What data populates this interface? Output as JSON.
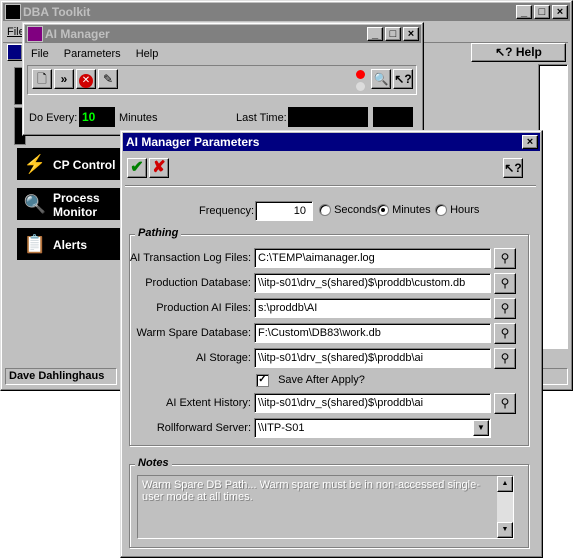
{
  "toolkit": {
    "title": "DBA Toolkit",
    "menu_file": "File",
    "help": "Help",
    "status_user": "Dave Dahlinghaus",
    "nav": [
      {
        "label": "CP Control",
        "icon": "cp-control-icon"
      },
      {
        "label": "Process Monitor",
        "icon": "process-monitor-icon"
      },
      {
        "label": "Alerts",
        "icon": "alerts-icon"
      }
    ]
  },
  "ai_manager": {
    "title": "AI Manager",
    "menu": [
      "File",
      "Parameters",
      "Help"
    ],
    "do_every_label": "Do Every:",
    "do_every_value": "10",
    "do_every_unit": "Minutes",
    "last_time_label": "Last Time:"
  },
  "params": {
    "title": "AI Manager Parameters",
    "frequency_label": "Frequency:",
    "frequency_value": "10",
    "unit_seconds": "Seconds",
    "unit_minutes": "Minutes",
    "unit_hours": "Hours",
    "selected_unit": "Minutes",
    "pathing_label": "Pathing",
    "fields": [
      {
        "label": "AI Transaction Log Files:",
        "value": "C:\\TEMP\\aimanager.log"
      },
      {
        "label": "Production Database:",
        "value": "\\\\itp-s01\\drv_s(shared)$\\proddb\\custom.db"
      },
      {
        "label": "Production AI Files:",
        "value": "s:\\proddb\\AI"
      },
      {
        "label": "Warm Spare Database:",
        "value": "F:\\Custom\\DB83\\work.db"
      },
      {
        "label": "AI Storage:",
        "value": "\\\\itp-s01\\drv_s(shared)$\\proddb\\ai"
      }
    ],
    "save_after_apply": "Save After Apply?",
    "extent_label": "AI Extent History:",
    "extent_value": "\\\\itp-s01\\drv_s(shared)$\\proddb\\ai",
    "rollforward_label": "Rollforward Server:",
    "rollforward_value": "\\\\ITP-S01",
    "notes_label": "Notes",
    "notes_text": "Warm Spare DB Path... Warm spare must be in non-accessed single-user mode at all times."
  },
  "colors": {
    "title_active": "#000080",
    "title_inactive": "#808080",
    "face": "#c0c0c0",
    "lcd_text": "#00ff00"
  }
}
